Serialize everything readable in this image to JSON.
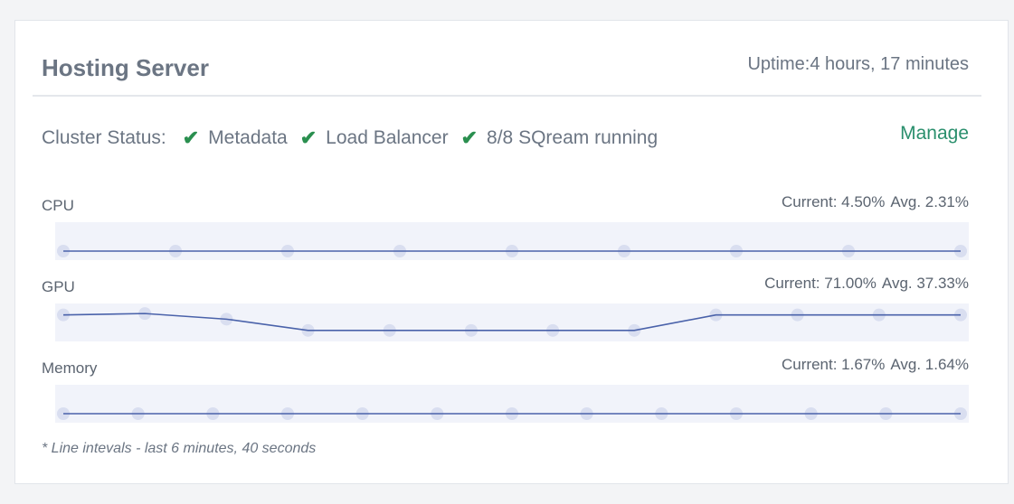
{
  "header": {
    "title": "Hosting Server",
    "uptime": "Uptime:4 hours, 17 minutes"
  },
  "cluster_status": {
    "label": "Cluster Status:",
    "items": [
      "Metadata",
      "Load Balancer",
      "8/8 SQream running"
    ],
    "manage_label": "Manage"
  },
  "colors": {
    "line": "#4a62aa",
    "dot": "#d9def0",
    "band": "#f1f3fa",
    "check": "#2a8f4f",
    "link": "#2a8f6d"
  },
  "metrics": [
    {
      "label": "CPU",
      "current": "Current: 4.50%",
      "avg": "Avg. 2.31%",
      "values": [
        4.5,
        4.5,
        4.5,
        4.5,
        4.5,
        4.5,
        4.5,
        4.5,
        4.5
      ]
    },
    {
      "label": "GPU",
      "current": "Current: 71.00%",
      "avg": "Avg. 37.33%",
      "values": [
        71,
        74,
        62,
        38,
        38,
        38,
        38,
        38,
        71,
        71,
        71,
        71
      ]
    },
    {
      "label": "Memory",
      "current": "Current: 1.67%",
      "avg": "Avg. 1.64%",
      "values": [
        1.67,
        1.67,
        1.67,
        1.67,
        1.67,
        1.67,
        1.67,
        1.67,
        1.67,
        1.67,
        1.67,
        1.67,
        1.67
      ]
    }
  ],
  "footnote": "* Line intevals - last 6 minutes, 40 seconds"
}
